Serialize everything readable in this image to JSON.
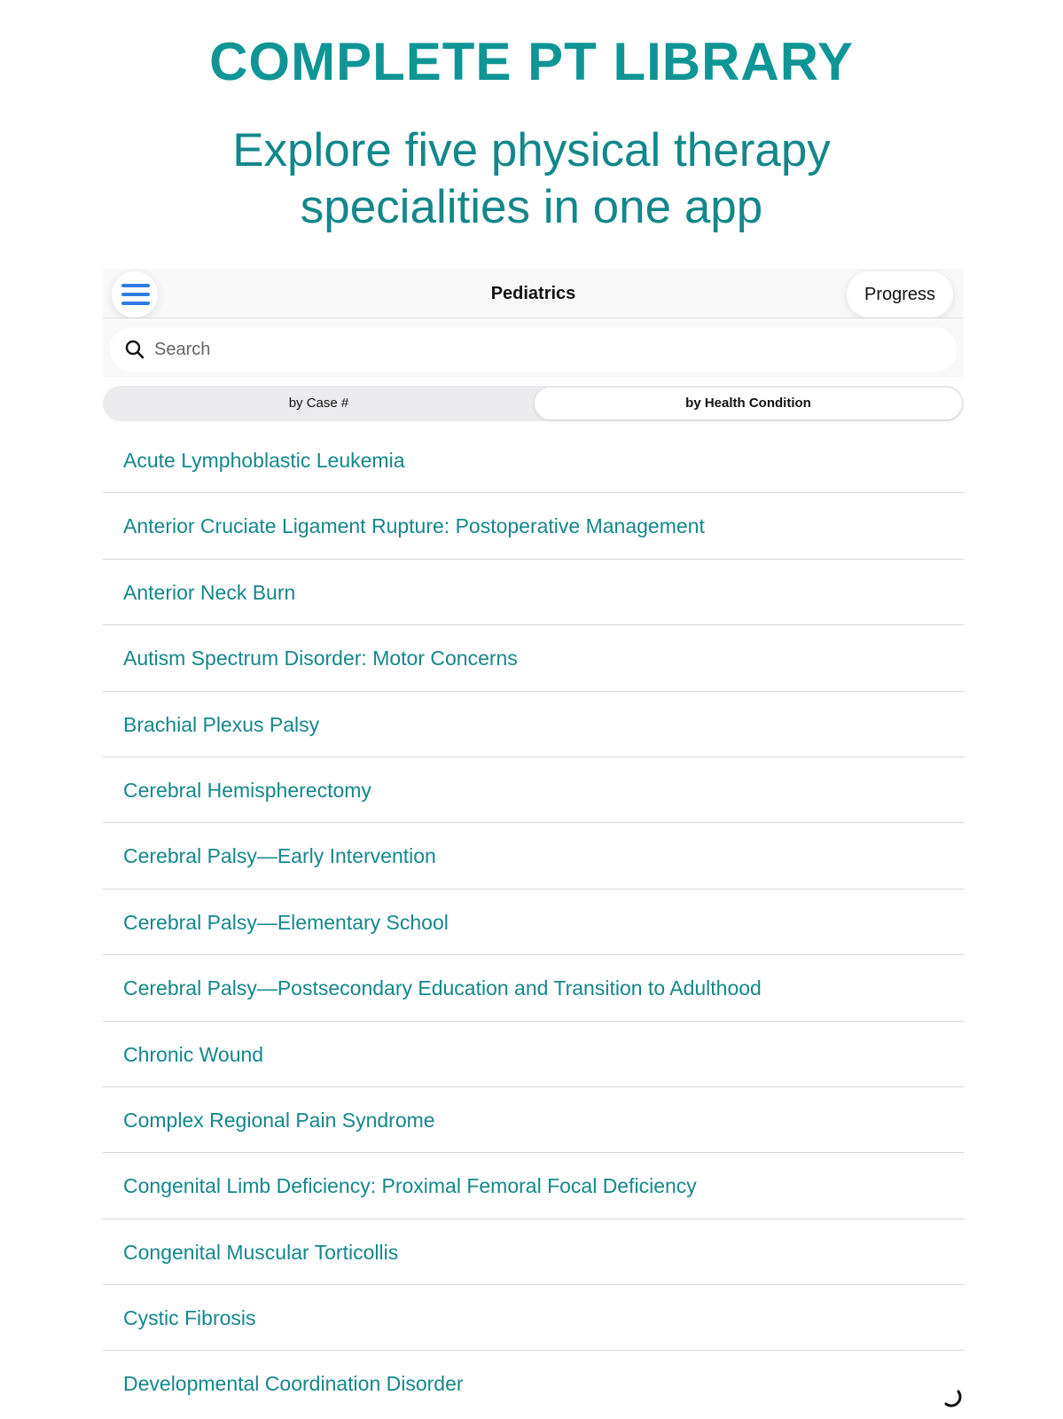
{
  "promo": {
    "title": "COMPLETE PT LIBRARY",
    "subtitle_line1": "Explore five physical therapy",
    "subtitle_line2": "specialities in one app"
  },
  "nav": {
    "menu_icon": "hamburger-menu-icon",
    "title": "Pediatrics",
    "progress_label": "Progress"
  },
  "search": {
    "placeholder": "Search",
    "icon": "magnifier-icon"
  },
  "segments": {
    "by_case": "by Case #",
    "by_health_condition": "by Health Condition",
    "selected": "by Health Condition"
  },
  "conditions": [
    "Acute Lymphoblastic Leukemia",
    "Anterior Cruciate Ligament Rupture: Postoperative Management",
    "Anterior Neck Burn",
    "Autism Spectrum Disorder: Motor Concerns",
    "Brachial Plexus Palsy",
    "Cerebral Hemispherectomy",
    "Cerebral Palsy—Early Intervention",
    "Cerebral Palsy—Elementary School",
    "Cerebral Palsy—Postsecondary Education and Transition to Adulthood",
    "Chronic Wound",
    "Complex Regional Pain Syndrome",
    "Congenital Limb Deficiency: Proximal Femoral Focal Deficiency",
    "Congenital Muscular Torticollis",
    "Cystic Fibrosis",
    "Developmental Coordination Disorder"
  ],
  "colors": {
    "accent": "#0f9595",
    "list_text": "#15878b",
    "menu_icon": "#2f7be6"
  }
}
